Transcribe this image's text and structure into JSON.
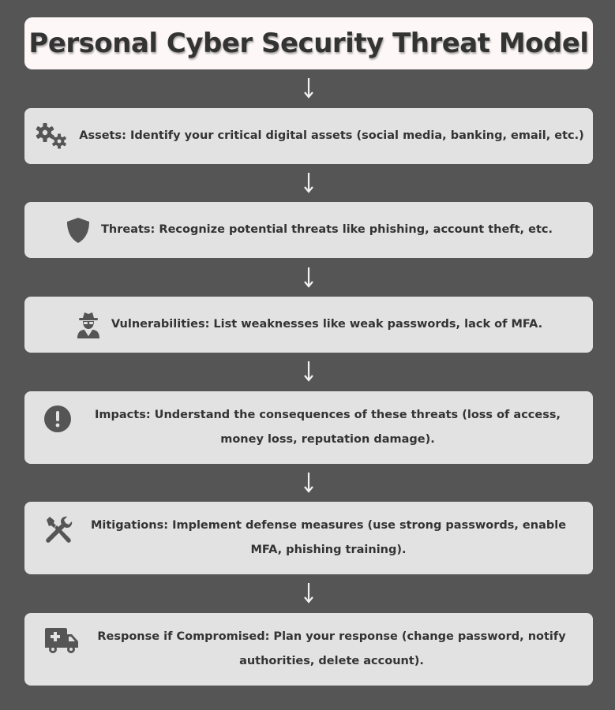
{
  "title": "Personal Cyber Security Threat Model",
  "colors": {
    "background": "#555555",
    "title_box": "#fdf7f7",
    "step_box": "#e2e2e2",
    "text": "#333333",
    "icon": "#555555",
    "arrow": "#f2f2f2"
  },
  "steps": [
    {
      "icon": "cogs-icon",
      "text": "Assets: Identify your critical digital assets (social media, banking, email, etc.)"
    },
    {
      "icon": "shield-icon",
      "text": "Threats: Recognize potential threats like phishing, account theft, etc."
    },
    {
      "icon": "user-secret-icon",
      "text": "Vulnerabilities: List weaknesses like weak passwords, lack of MFA."
    },
    {
      "icon": "exclamation-circle-icon",
      "text": "Impacts: Understand the consequences of these threats (loss of access, money loss, reputation damage)."
    },
    {
      "icon": "tools-icon",
      "text": "Mitigations: Implement defense measures (use strong passwords, enable MFA, phishing training)."
    },
    {
      "icon": "ambulance-icon",
      "text": "Response if Compromised: Plan your response (change password, notify authorities, delete account)."
    }
  ]
}
